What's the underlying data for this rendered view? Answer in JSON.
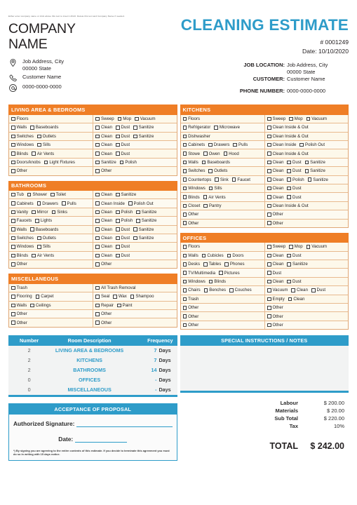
{
  "header": {
    "logo_hint": "Either enter company name or click above this text to insert LOGO. Delete this text and Company Name if needed.",
    "company_line1": "COMPANY",
    "company_line2": "NAME",
    "contacts": [
      {
        "icon": "location-pin-icon",
        "line1": "Job Address, City",
        "line2": "00000 State"
      },
      {
        "icon": "phone-icon",
        "line1": "Customer Name",
        "line2": ""
      },
      {
        "icon": "at-sign-icon",
        "line1": "0000-0000-0000",
        "line2": ""
      }
    ],
    "doc_title": "CLEANING ESTIMATE",
    "doc_number": "# 0001249",
    "doc_date": "Date: 10/10/2020",
    "meta": [
      {
        "label": "JOB LOCATION:",
        "value": "Job Address, City",
        "value2": "00000 State"
      },
      {
        "label": "CUSTOMER:",
        "value": "Customer Name",
        "value2": ""
      },
      {
        "label": "PHONE NUMBER:",
        "value": "0000-0000-0000",
        "value2": ""
      }
    ]
  },
  "colors": {
    "orange": "#EF7E26",
    "blue": "#2E9CC9",
    "row_cream": "#FDF8EA",
    "panel_gray": "#F2F3F3"
  },
  "blocks": [
    {
      "id": "living-area-bedrooms",
      "title": "LIVING AREA & BEDROOMS",
      "column": "left",
      "rows": [
        {
          "left": [
            "Floors"
          ],
          "right": [
            "Sweep",
            "Mop",
            "Vacuum"
          ]
        },
        {
          "left": [
            "Walls",
            "Baseboards"
          ],
          "right": [
            "Clean",
            "Dust",
            "Sanitize"
          ]
        },
        {
          "left": [
            "Switches",
            "Outlets"
          ],
          "right": [
            "Clean",
            "Dust",
            "Sanitize"
          ]
        },
        {
          "left": [
            "Windows",
            "Sills"
          ],
          "right": [
            "Clean",
            "Dust"
          ]
        },
        {
          "left": [
            "Blinds",
            "Air Vents"
          ],
          "right": [
            "Clean",
            "Dust"
          ]
        },
        {
          "left": [
            "Doors/knobs",
            "Light Fixtures"
          ],
          "right": [
            "Sanitize",
            "Polish"
          ]
        },
        {
          "left": [
            "Other"
          ],
          "right": [
            "Other"
          ]
        }
      ]
    },
    {
      "id": "bathrooms",
      "title": "BATHROOMS",
      "column": "left",
      "rows": [
        {
          "left": [
            "Tub",
            "Shower",
            "Toilet"
          ],
          "right": [
            "Clean",
            "Sanitize"
          ]
        },
        {
          "left": [
            "Cabinets",
            "Drawers",
            "Pulls"
          ],
          "right": [
            "Clean Inside",
            "Polish Out"
          ]
        },
        {
          "left": [
            "Vanity",
            "Mirror",
            "Sinks"
          ],
          "right": [
            "Clean",
            "Polish",
            "Sanitize"
          ]
        },
        {
          "left": [
            "Faucets",
            "Lights"
          ],
          "right": [
            "Clean",
            "Polish",
            "Sanitize"
          ]
        },
        {
          "left": [
            "Walls",
            "Baseboards"
          ],
          "right": [
            "Clean",
            "Dust",
            "Sanitize"
          ]
        },
        {
          "left": [
            "Switches",
            "Outlets"
          ],
          "right": [
            "Clean",
            "Dust",
            "Sanitize"
          ]
        },
        {
          "left": [
            "Windows",
            "Sills"
          ],
          "right": [
            "Clean",
            "Dust"
          ]
        },
        {
          "left": [
            "Blinds",
            "Air Vents"
          ],
          "right": [
            "Clean",
            "Dust"
          ]
        },
        {
          "left": [
            "Other"
          ],
          "right": [
            "Other"
          ]
        }
      ]
    },
    {
      "id": "miscellaneous",
      "title": "MISCELLANEOUS",
      "column": "left",
      "rows": [
        {
          "left": [
            "Trash"
          ],
          "right": [
            "All Trash Removal"
          ]
        },
        {
          "left": [
            "Flooring",
            "Carpet"
          ],
          "right": [
            "Seal",
            "Wax",
            "Shampoo"
          ]
        },
        {
          "left": [
            "Walls",
            "Ceilings"
          ],
          "right": [
            "Repair",
            "Paint"
          ]
        },
        {
          "left": [
            "Other"
          ],
          "right": [
            "Other"
          ]
        },
        {
          "left": [
            "Other"
          ],
          "right": [
            "Other"
          ]
        }
      ]
    },
    {
      "id": "kitchens",
      "title": "KITCHENS",
      "column": "right",
      "rows": [
        {
          "left": [
            "Floors"
          ],
          "right": [
            "Sweep",
            "Mop",
            "Vacuum"
          ]
        },
        {
          "left": [
            "Refrigerator",
            "Microwave"
          ],
          "right": [
            "Clean Inside & Out"
          ]
        },
        {
          "left": [
            "Dishwasher"
          ],
          "right": [
            "Clean Inside & Out"
          ]
        },
        {
          "left": [
            "Cabinets",
            "Drawers",
            "Pulls"
          ],
          "right": [
            "Clean Inside",
            "Polish Out"
          ]
        },
        {
          "left": [
            "Stowe",
            "Owen",
            "Hood"
          ],
          "right": [
            "Clean Inside & Out"
          ]
        },
        {
          "left": [
            "Walls",
            "Baseboards"
          ],
          "right": [
            "Clean",
            "Dust",
            "Sanitize"
          ]
        },
        {
          "left": [
            "Switches",
            "Outlets"
          ],
          "right": [
            "Clean",
            "Dust",
            "Sanitize"
          ]
        },
        {
          "left": [
            "Countertops",
            "Sink",
            "Faucet"
          ],
          "right": [
            "Clean",
            "Polish",
            "Sanitize"
          ]
        },
        {
          "left": [
            "Windows",
            "Sills"
          ],
          "right": [
            "Clean",
            "Dust"
          ]
        },
        {
          "left": [
            "Blinds",
            "Air Vents"
          ],
          "right": [
            "Clean",
            "Dust"
          ]
        },
        {
          "left": [
            "Closet",
            "Pantry"
          ],
          "right": [
            "Clean Inside & Out"
          ]
        },
        {
          "left": [
            "Other"
          ],
          "right": [
            "Other"
          ]
        },
        {
          "left": [
            "Other"
          ],
          "right": [
            "Other"
          ]
        }
      ]
    },
    {
      "id": "offices",
      "title": "OFFICES",
      "column": "right",
      "rows": [
        {
          "left": [
            "Floors"
          ],
          "right": [
            "Sweep",
            "Mop",
            "Vacuum"
          ]
        },
        {
          "left": [
            "Walls",
            "Cubicles",
            "Doors"
          ],
          "right": [
            "Clean",
            "Dust"
          ]
        },
        {
          "left": [
            "Desks",
            "Tables",
            "Phones"
          ],
          "right": [
            "Clean",
            "Sanitize"
          ]
        },
        {
          "left": [
            "TV/Multimedia",
            "Pictures"
          ],
          "right": [
            "Dust"
          ]
        },
        {
          "left": [
            "Windows",
            "Blinds"
          ],
          "right": [
            "Clean",
            "Dust"
          ]
        },
        {
          "left": [
            "Chairs",
            "Benches",
            "Couches"
          ],
          "right": [
            "Vacuum",
            "Clean",
            "Dust"
          ]
        },
        {
          "left": [
            "Trash"
          ],
          "right": [
            "Empty",
            "Clean"
          ]
        },
        {
          "left": [
            "Other"
          ],
          "right": [
            "Other"
          ]
        },
        {
          "left": [
            "Other"
          ],
          "right": [
            "Other"
          ]
        },
        {
          "left": [
            "Other"
          ],
          "right": [
            "Other"
          ]
        }
      ]
    }
  ],
  "summary": {
    "headers": [
      "Number",
      "Room Description",
      "Frequency"
    ],
    "rows": [
      {
        "number": "2",
        "description": "LIVING AREA & BEDROOMS",
        "frequency": "7",
        "unit": "Days"
      },
      {
        "number": "2",
        "description": "KITCHENS",
        "frequency": "7",
        "unit": "Days"
      },
      {
        "number": "2",
        "description": "BATHROOMS",
        "frequency": "14",
        "unit": "Days"
      },
      {
        "number": "0",
        "description": "OFFICES",
        "frequency": "-",
        "unit": "Days"
      },
      {
        "number": "0",
        "description": "MISCELLANEOUS",
        "frequency": "-",
        "unit": "Days"
      }
    ]
  },
  "notes": {
    "title": "SPECIAL INSTRUCTIONS / NOTES",
    "body": ""
  },
  "acceptance": {
    "title": "ACCEPTANCE OF PROPOSAL",
    "signature_label": "Authorized Signature:",
    "date_label": "Date:",
    "fineprint_line1": "*) By signing you are agreeing to the entire contents of this estimate. If you decide to terminate",
    "fineprint_line2": "this agreement you must do so in writing with 15 days notice."
  },
  "totals": {
    "rows": [
      {
        "label": "Labour",
        "value": "$ 200.00"
      },
      {
        "label": "Materials",
        "value": "$ 20.00"
      },
      {
        "label": "Sub Total",
        "value": "$ 220.00"
      },
      {
        "label": "Tax",
        "value": "10%"
      }
    ],
    "grand_label": "TOTAL",
    "grand_value": "$ 242.00"
  }
}
